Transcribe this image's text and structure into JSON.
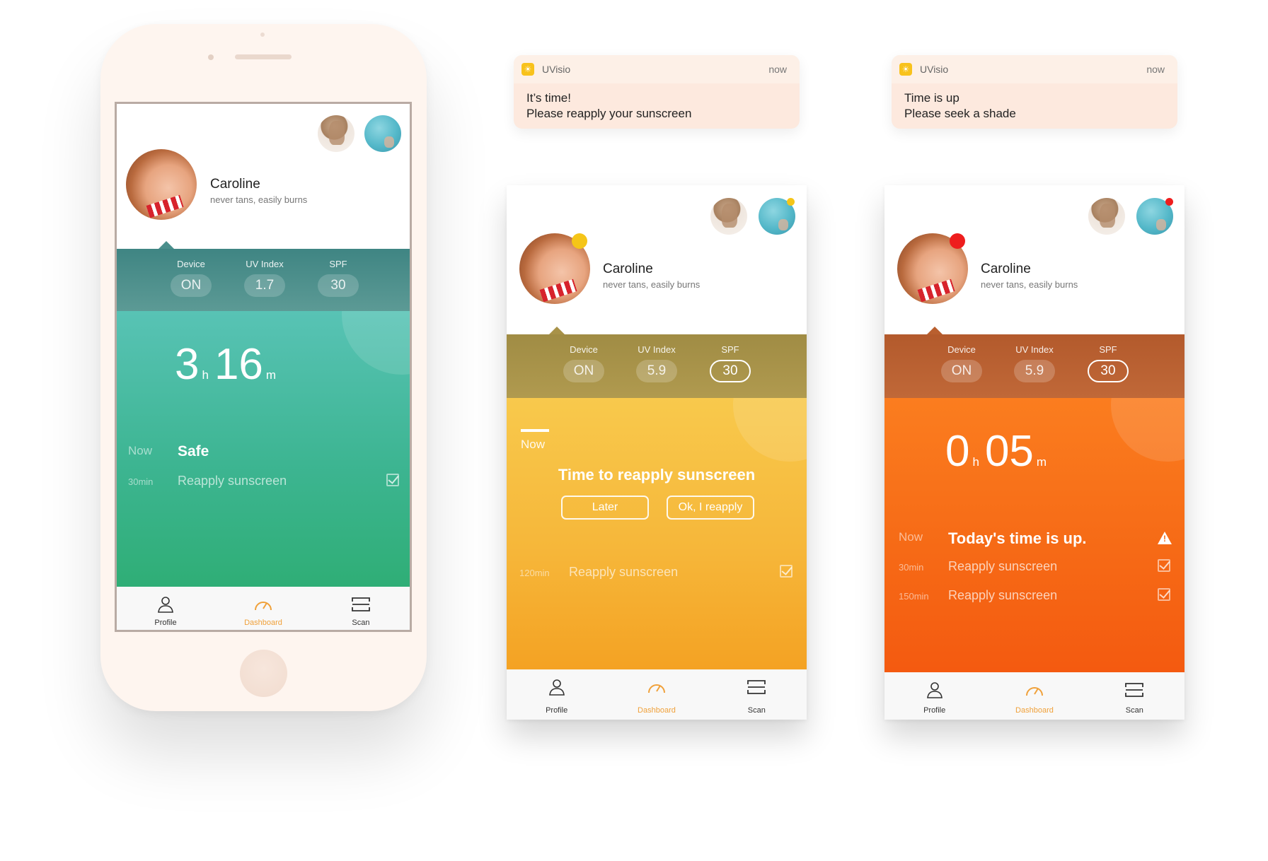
{
  "common": {
    "name": "Caroline",
    "subtitle": "never tans, easily burns",
    "stats": {
      "device_label": "Device",
      "uv_label": "UV Index",
      "spf_label": "SPF"
    },
    "tabs": {
      "profile": "Profile",
      "dashboard": "Dashboard",
      "scan": "Scan"
    },
    "accent_color": "#f0a13a"
  },
  "screen_green": {
    "device": "ON",
    "uv": "1.7",
    "spf": "30",
    "timer": {
      "hours": "3",
      "h_unit": "h",
      "minutes": "16",
      "m_unit": "m"
    },
    "rows": [
      {
        "time": "Now",
        "text": "Safe"
      },
      {
        "time": "30min",
        "text": "Reapply sunscreen"
      }
    ],
    "colors": {
      "header": "#4a8f8c",
      "top": "#56c4b4",
      "bottom": "#2fae76"
    }
  },
  "notif1": {
    "app": "UVisio",
    "time": "now",
    "line1": "It’s time!",
    "line2": "Please reapply your sunscreen"
  },
  "notif2": {
    "app": "UVisio",
    "time": "now",
    "line1": "Time is up",
    "line2": "Please seek a shade"
  },
  "screen_yellow": {
    "device": "ON",
    "uv": "5.9",
    "spf": "30",
    "now_label": "Now",
    "headline": "Time to reapply sunscreen",
    "later_button": "Later",
    "ok_button": "Ok, I reapply",
    "rows": [
      {
        "time": "120min",
        "text": "Reapply sunscreen"
      }
    ],
    "colors": {
      "header": "#a89248",
      "top": "#f7c94b",
      "bottom": "#f4a223",
      "dot": "#f5c518"
    }
  },
  "screen_orange": {
    "device": "ON",
    "uv": "5.9",
    "spf": "30",
    "timer": {
      "hours": "0",
      "h_unit": "h",
      "minutes": "05",
      "m_unit": "m"
    },
    "rows": [
      {
        "time": "Now",
        "text": "Today's time is up."
      },
      {
        "time": "30min",
        "text": "Reapply sunscreen"
      },
      {
        "time": "150min",
        "text": "Reapply sunscreen"
      }
    ],
    "colors": {
      "header": "#b95f2f",
      "top": "#fb7d1f",
      "bottom": "#f45a10",
      "dot": "#ee1d1d"
    }
  }
}
